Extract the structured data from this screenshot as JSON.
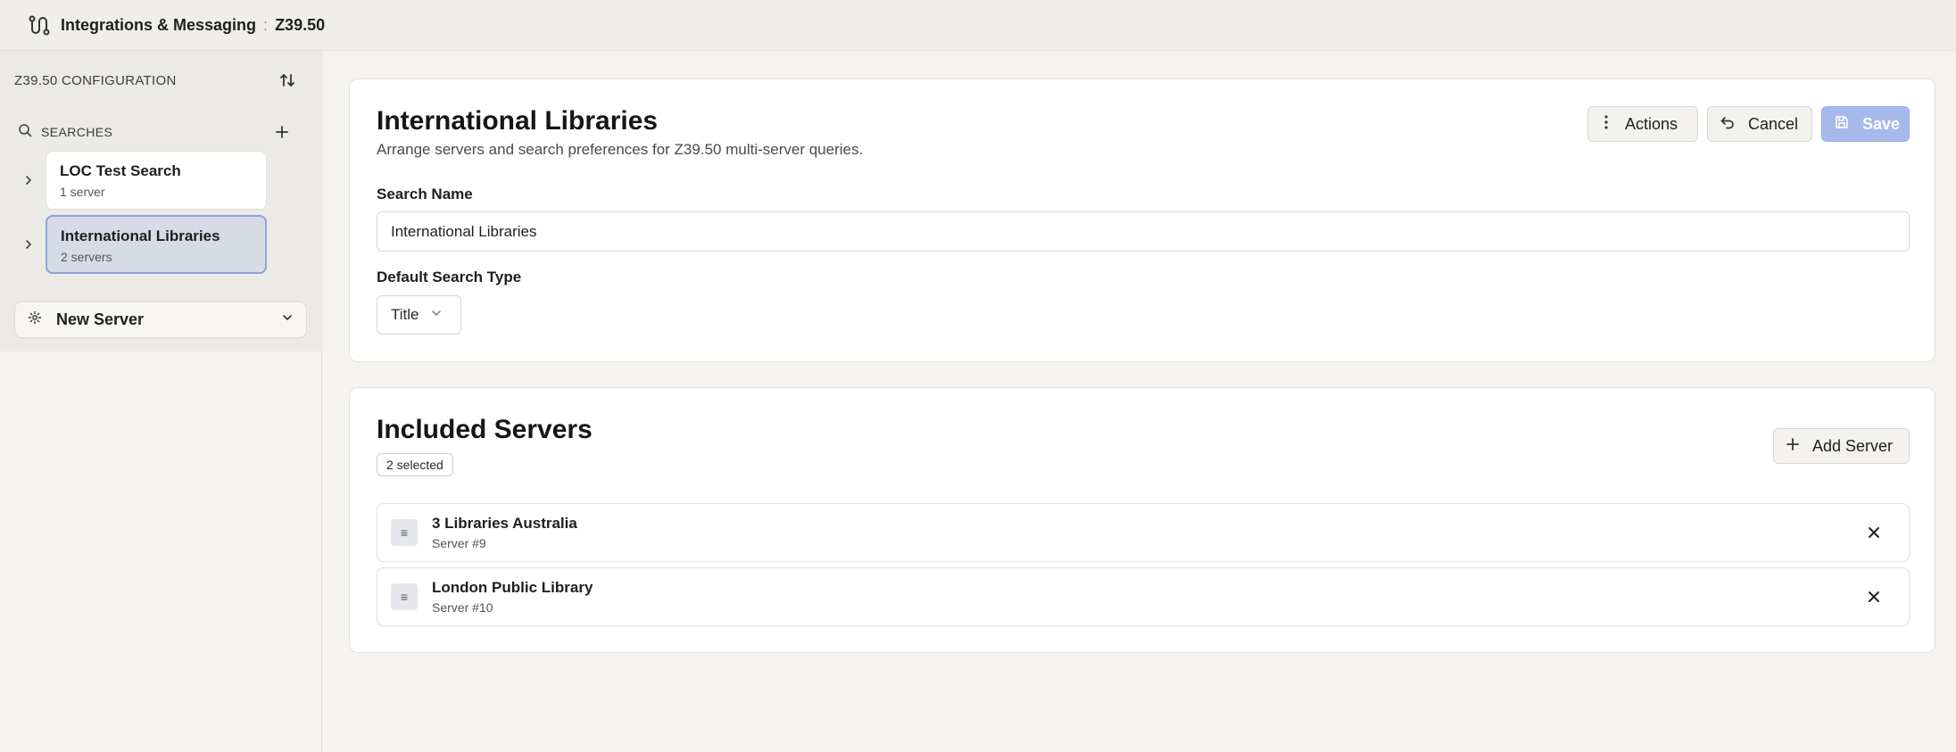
{
  "topbar": {
    "icon": "integrations-icon",
    "title": "Integrations & Messaging",
    "separator": ":",
    "crumb": "Z39.50"
  },
  "sidebar": {
    "section_label": "Z39.50 CONFIGURATION",
    "sort_icon": "sort-arrows-icon",
    "searches_label": "SEARCHES",
    "searches": [
      {
        "name": "LOC Test Search",
        "sub": "1 server",
        "active": false
      },
      {
        "name": "International Libraries",
        "sub": "2 servers",
        "active": true
      }
    ],
    "new_server_label": "New Server"
  },
  "search_panel": {
    "title": "International Libraries",
    "description": "Arrange servers and search preferences for Z39.50 multi-server queries.",
    "actions_label": "Actions",
    "cancel_label": "Cancel",
    "save_label": "Save",
    "search_name_label": "Search Name",
    "search_name_value": "International Libraries",
    "default_type_label": "Default Search Type",
    "default_type_value": "Title"
  },
  "servers_panel": {
    "title": "Included Servers",
    "selected_badge": "2 selected",
    "add_label": "Add Server",
    "servers": [
      {
        "name": "3 Libraries Australia",
        "sub": "Server #9"
      },
      {
        "name": "London Public Library",
        "sub": "Server #10"
      }
    ]
  },
  "colors": {
    "accent": "#a7b8ea",
    "active_item_bg": "#d6dbe6",
    "active_item_border": "#8fa4d8"
  }
}
